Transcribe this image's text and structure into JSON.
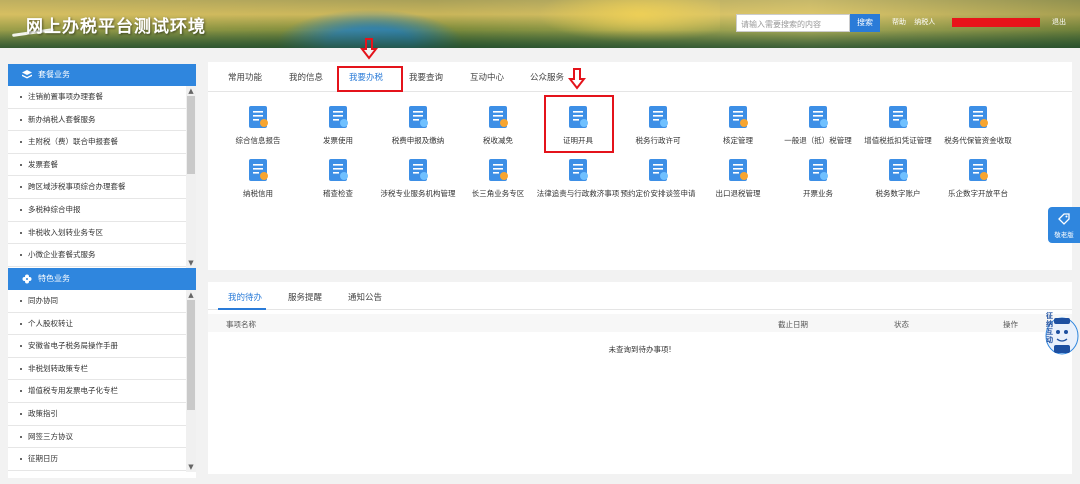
{
  "header": {
    "title": "网上办税平台测试环境",
    "search_placeholder": "请输入需要搜索的内容",
    "search_button": "搜索",
    "user_links": [
      "帮助",
      "纳税人"
    ],
    "logout": "退出"
  },
  "sidebar": {
    "sections": [
      {
        "title": "套餐业务",
        "icon": "package-icon",
        "items": [
          "注销前置事项办理套餐",
          "新办纳税人套餐服务",
          "主附税（费）联合申报套餐",
          "发票套餐",
          "跨区域涉税事项综合办理套餐",
          "多税种综合申报",
          "非税收入划转业务专区",
          "小微企业套餐式服务"
        ]
      },
      {
        "title": "特色业务",
        "icon": "flower-icon",
        "items": [
          "同办协同",
          "个人股权转让",
          "安徽省电子税务局操作手册",
          "非税划转政策专栏",
          "增值税专用发票电子化专栏",
          "政策指引",
          "网签三方协议",
          "征期日历"
        ]
      }
    ]
  },
  "main": {
    "tabs": [
      "常用功能",
      "我的信息",
      "我要办税",
      "我要查询",
      "互动中心",
      "公众服务"
    ],
    "active_tab": "我要办税",
    "functions_row1": [
      "综合信息报告",
      "发票使用",
      "税费申报及缴纳",
      "税收减免",
      "证明开具",
      "税务行政许可",
      "核定管理",
      "一般退（抵）税管理",
      "增值税抵扣凭证管理",
      "税务代保管资金收取"
    ],
    "functions_row2": [
      "纳税信用",
      "稽查检查",
      "涉税专业服务机构管理",
      "长三角业务专区",
      "法律追责与行政救济事项",
      "预约定价安排谈签申请",
      "出口退税管理",
      "开票业务",
      "税务数字账户",
      "乐企数字开放平台"
    ],
    "highlighted_function": "证明开具"
  },
  "tasks": {
    "tabs": [
      "我的待办",
      "服务提醒",
      "通知公告"
    ],
    "active_tab": "我的待办",
    "columns": [
      "事项名称",
      "截止日期",
      "状态",
      "操作"
    ],
    "empty_text": "未查询到待办事项!"
  },
  "floating": {
    "elder_label": "敬老版",
    "robot_label": "征纳互动"
  },
  "colors": {
    "accent": "#2a7bd8",
    "sidebar_header": "#2f86de",
    "highlight_red": "#e4131b"
  }
}
